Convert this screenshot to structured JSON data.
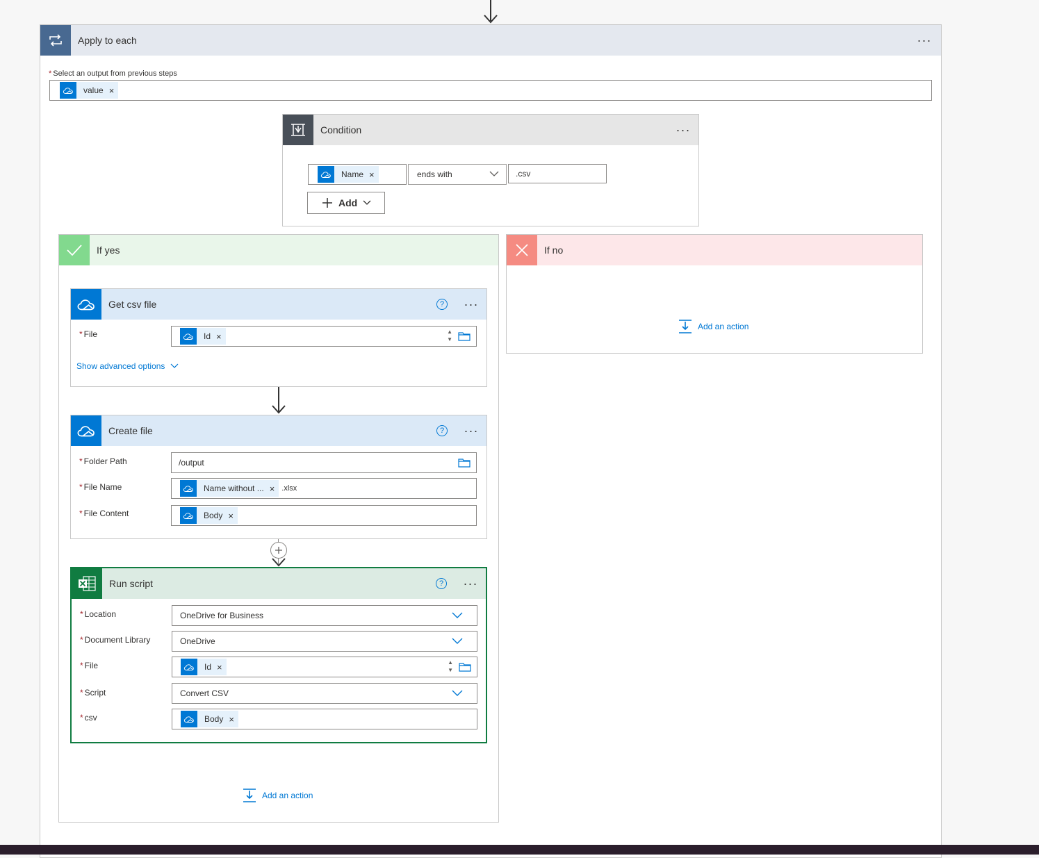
{
  "apply_each": {
    "title": "Apply to each",
    "select_label": "Select an output from previous steps",
    "token": "value"
  },
  "condition": {
    "title": "Condition",
    "left_token": "Name",
    "operator": "ends with",
    "value": ".csv",
    "add_label": "Add"
  },
  "if_yes": {
    "title": "If yes",
    "add_action": "Add an action"
  },
  "if_no": {
    "title": "If no",
    "add_action": "Add an action"
  },
  "get_csv": {
    "title": "Get csv file",
    "file_label": "File",
    "file_token": "Id",
    "advanced": "Show advanced options"
  },
  "create_file": {
    "title": "Create file",
    "folder_label": "Folder Path",
    "folder_value": "/output",
    "name_label": "File Name",
    "name_token": "Name without ...",
    "name_suffix": ".xlsx",
    "content_label": "File Content",
    "content_token": "Body"
  },
  "run_script": {
    "title": "Run script",
    "location_label": "Location",
    "location_value": "OneDrive for Business",
    "library_label": "Document Library",
    "library_value": "OneDrive",
    "file_label": "File",
    "file_token": "Id",
    "script_label": "Script",
    "script_value": "Convert CSV",
    "csv_label": "csv",
    "csv_token": "Body"
  },
  "colors": {
    "onedrive": "#0078d4",
    "excel": "#107c41",
    "yes_green": "#82d98e",
    "no_red": "#f58b82",
    "loop_blue": "#486991",
    "condition_dark": "#484f58"
  },
  "icons": [
    "loop-icon",
    "onedrive-icon",
    "condition-icon",
    "check-icon",
    "close-icon",
    "excel-icon",
    "add-action-icon",
    "folder-icon",
    "help-icon",
    "chevron-down-icon"
  ]
}
